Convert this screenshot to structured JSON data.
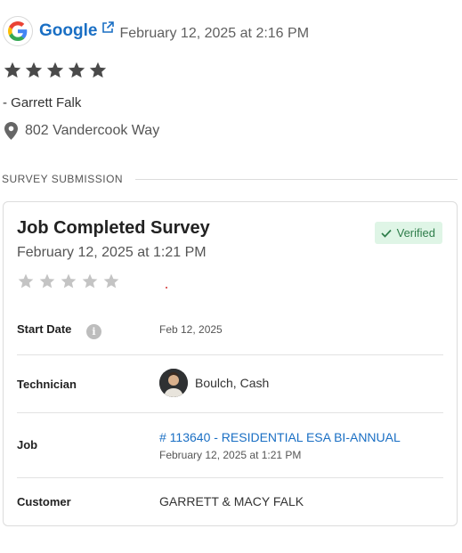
{
  "review": {
    "source_name": "Google",
    "date": "February 12, 2025 at 2:16 PM",
    "rating": 5,
    "reviewer": "- Garrett Falk",
    "address": "802 Vandercook Way",
    "icons": {
      "source_logo": "google-logo",
      "external_link": "external-link-icon",
      "address": "map-pin-icon",
      "star": "star-icon"
    }
  },
  "section": {
    "label": "SURVEY SUBMISSION"
  },
  "survey": {
    "title": "Job Completed Survey",
    "date": "February 12, 2025 at 1:21 PM",
    "badge": "Verified",
    "rating": 0,
    "colors": {
      "badge_bg": "#dff5e6",
      "badge_text": "#2e7d4a",
      "link": "#1a6fc4",
      "star_filled": "#4a4a4a",
      "star_empty": "#c4c4c4"
    },
    "fields": {
      "start_date": {
        "label": "Start Date",
        "value": "Feb 12, 2025"
      },
      "technician": {
        "label": "Technician",
        "value": "Boulch, Cash"
      },
      "job": {
        "label": "Job",
        "link": "# 113640 - RESIDENTIAL ESA BI-ANNUAL",
        "date": "February 12, 2025 at 1:21 PM"
      },
      "customer": {
        "label": "Customer",
        "value": "GARRETT & MACY FALK"
      }
    }
  }
}
